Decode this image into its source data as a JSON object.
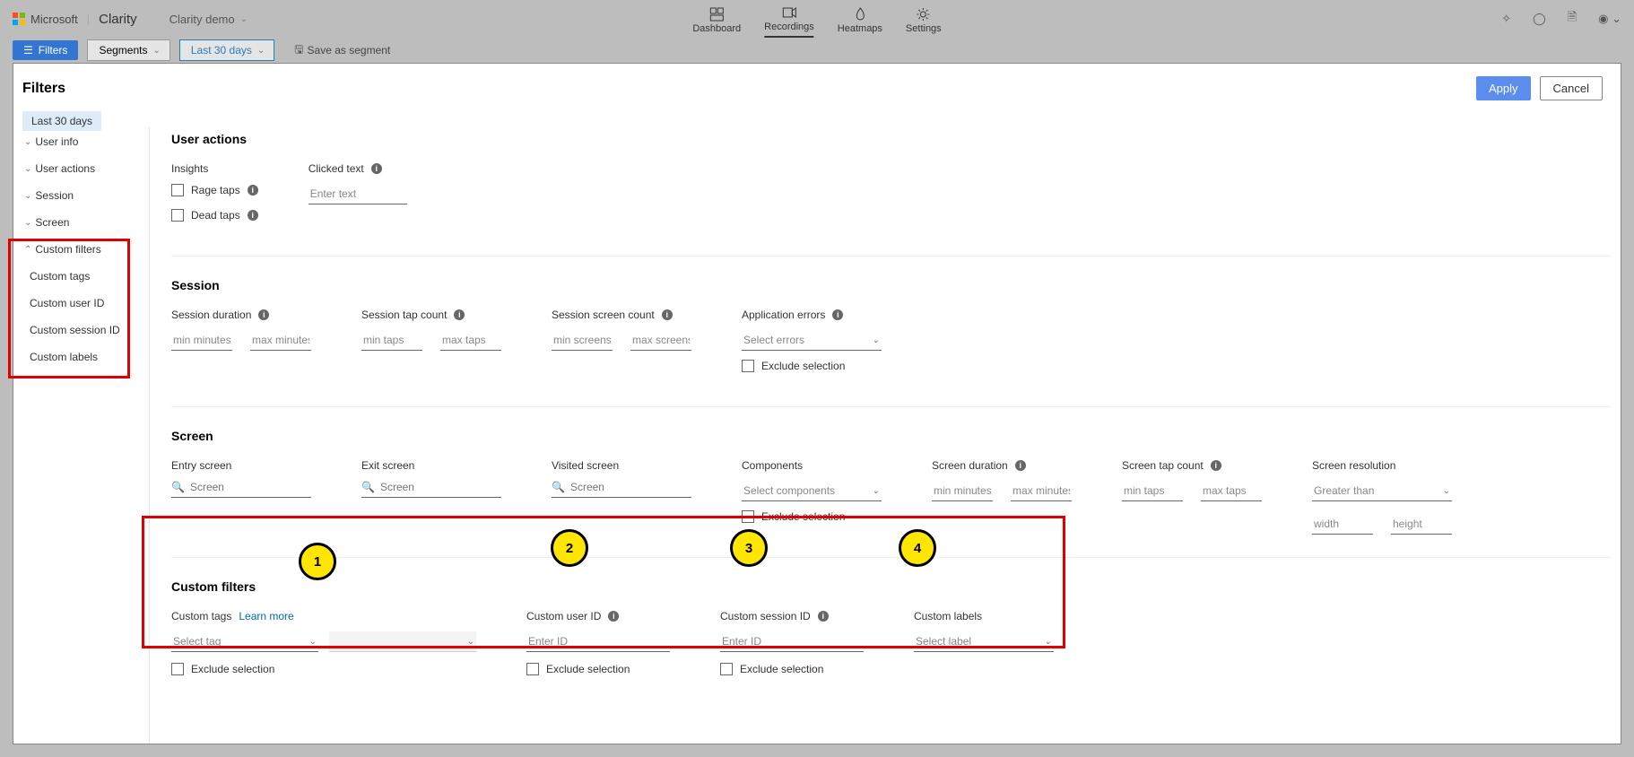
{
  "top": {
    "ms": "Microsoft",
    "clarity": "Clarity",
    "project": "Clarity demo",
    "nav": {
      "dashboard": "Dashboard",
      "recordings": "Recordings",
      "heatmaps": "Heatmaps",
      "settings": "Settings"
    }
  },
  "row2": {
    "filters": "Filters",
    "segments": "Segments",
    "last30": "Last 30 days",
    "save_segment": "Save as segment"
  },
  "modal": {
    "title": "Filters",
    "apply": "Apply",
    "cancel": "Cancel",
    "chip": "Last 30 days"
  },
  "sidebar": {
    "user_info": "User info",
    "user_actions": "User actions",
    "session": "Session",
    "screen": "Screen",
    "custom_filters": "Custom filters",
    "custom_tags": "Custom tags",
    "custom_user_id": "Custom user ID",
    "custom_session_id": "Custom session ID",
    "custom_labels": "Custom labels"
  },
  "ua": {
    "title": "User actions",
    "insights": "Insights",
    "rage": "Rage taps",
    "dead": "Dead taps",
    "clicked_text": "Clicked text",
    "enter_text": "Enter text"
  },
  "session": {
    "title": "Session",
    "duration": "Session duration",
    "tap_count": "Session tap count",
    "screen_count": "Session screen count",
    "app_errors": "Application errors",
    "select_errors": "Select errors",
    "exclude": "Exclude selection",
    "min_minutes": "min minutes",
    "max_minutes": "max minutes",
    "min_taps": "min taps",
    "max_taps": "max taps",
    "min_screens": "min screens",
    "max_screens": "max screens"
  },
  "screen": {
    "title": "Screen",
    "entry": "Entry screen",
    "exit": "Exit screen",
    "visited": "Visited screen",
    "components": "Components",
    "select_components": "Select components",
    "exclude": "Exclude selection",
    "duration": "Screen duration",
    "tap_count": "Screen tap count",
    "resolution": "Screen resolution",
    "greater_than": "Greater than",
    "screen_ph": "Screen",
    "min_minutes": "min minutes",
    "max_minutes": "max minutes",
    "min_taps": "min taps",
    "max_taps": "max taps",
    "width": "width",
    "height": "height"
  },
  "custom": {
    "title": "Custom filters",
    "tags": "Custom tags",
    "learn_more": "Learn more",
    "select_tag": "Select tag",
    "user_id": "Custom user ID",
    "session_id": "Custom session ID",
    "labels": "Custom labels",
    "select_label": "Select label",
    "enter_id": "Enter ID",
    "exclude": "Exclude selection"
  },
  "annot": {
    "1": "1",
    "2": "2",
    "3": "3",
    "4": "4"
  }
}
